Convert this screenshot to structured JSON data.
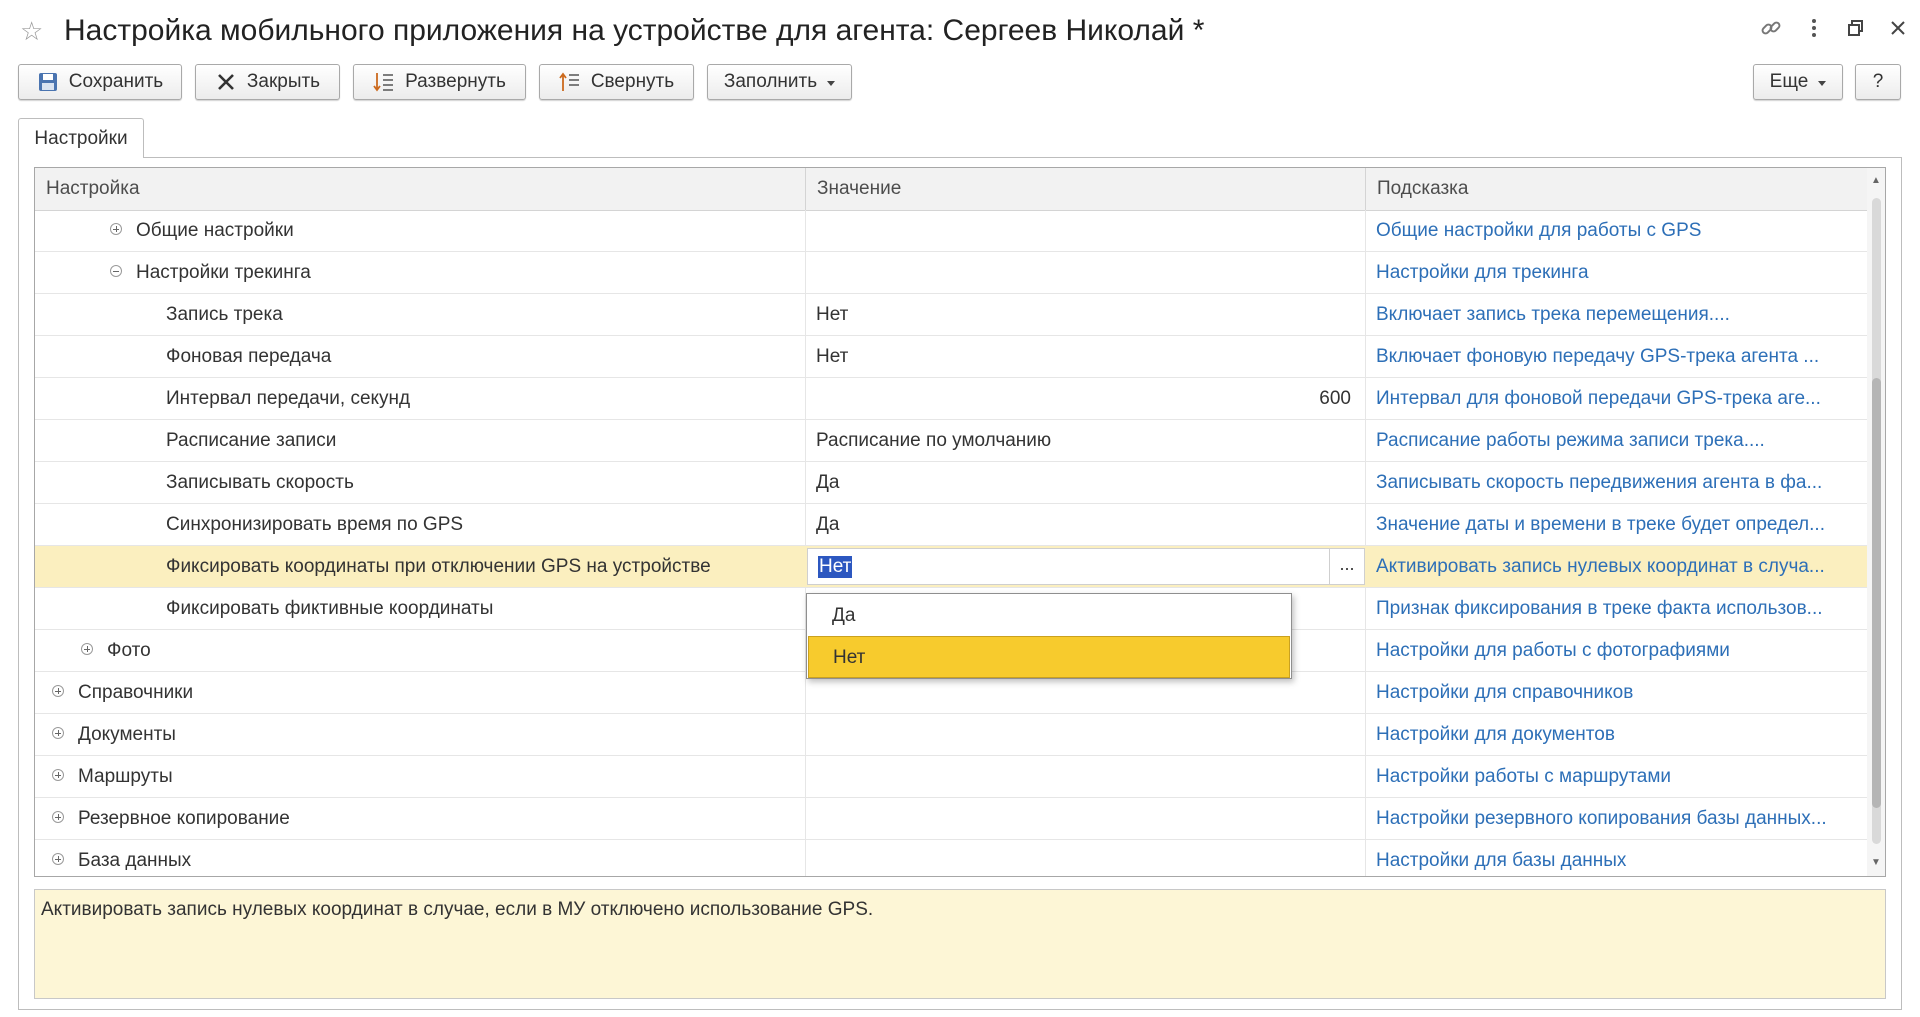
{
  "window": {
    "title": "Настройка мобильного приложения на устройстве для агента: Сергеев Николай *"
  },
  "toolbar": {
    "save": "Сохранить",
    "close": "Закрыть",
    "expand": "Развернуть",
    "collapse": "Свернуть",
    "fill": "Заполнить",
    "more": "Еще",
    "help": "?"
  },
  "tabs": [
    {
      "label": "Настройки"
    }
  ],
  "grid": {
    "columns": [
      "Настройка",
      "Значение",
      "Подсказка"
    ],
    "rows": [
      {
        "setting": "Общие настройки",
        "value": "",
        "hint": "Общие настройки для работы с GPS"
      },
      {
        "setting": "Настройки трекинга",
        "value": "",
        "hint": "Настройки для трекинга"
      },
      {
        "setting": "Запись трека",
        "value": "Нет",
        "hint": "Включает запись трека перемещения...."
      },
      {
        "setting": "Фоновая передача",
        "value": "Нет",
        "hint": "Включает фоновую передачу GPS-трека агента ..."
      },
      {
        "setting": "Интервал передачи, секунд",
        "value": "600",
        "hint": "Интервал для фоновой передачи GPS-трека аге..."
      },
      {
        "setting": "Расписание записи",
        "value": "Расписание по умолчанию",
        "hint": "Расписание работы режима записи трека...."
      },
      {
        "setting": "Записывать скорость",
        "value": "Да",
        "hint": "Записывать скорость передвижения агента в фа..."
      },
      {
        "setting": "Синхронизировать время по GPS",
        "value": "Да",
        "hint": "Значение даты и времени в треке будет определ..."
      },
      {
        "setting": "Фиксировать координаты при отключении GPS на устройстве",
        "value": "Нет",
        "hint": "Активировать запись нулевых координат в случа..."
      },
      {
        "setting": "Фиксировать фиктивные координаты",
        "value": "",
        "hint": "Признак фиксирования в треке факта использов..."
      },
      {
        "setting": "Фото",
        "value": "",
        "hint": "Настройки для работы с фотографиями"
      },
      {
        "setting": "Справочники",
        "value": "",
        "hint": "Настройки для справочников"
      },
      {
        "setting": "Документы",
        "value": "",
        "hint": "Настройки для документов"
      },
      {
        "setting": "Маршруты",
        "value": "",
        "hint": "Настройки работы с маршрутами"
      },
      {
        "setting": "Резервное копирование",
        "value": "",
        "hint": "Настройки резервного копирования базы данных..."
      },
      {
        "setting": "База данных",
        "value": "",
        "hint": "Настройки для базы данных"
      }
    ],
    "editor_dots": "..."
  },
  "dropdown": {
    "options": [
      "Да",
      "Нет"
    ],
    "selected": "Нет"
  },
  "description": "Активировать запись нулевых координат в случае, если в МУ отключено использование GPS.",
  "colors": {
    "hint_link": "#2d6fb7",
    "selected_row": "#fbefbf",
    "highlight_option": "#f7cb2d",
    "description_bg": "#fdf6d6"
  }
}
